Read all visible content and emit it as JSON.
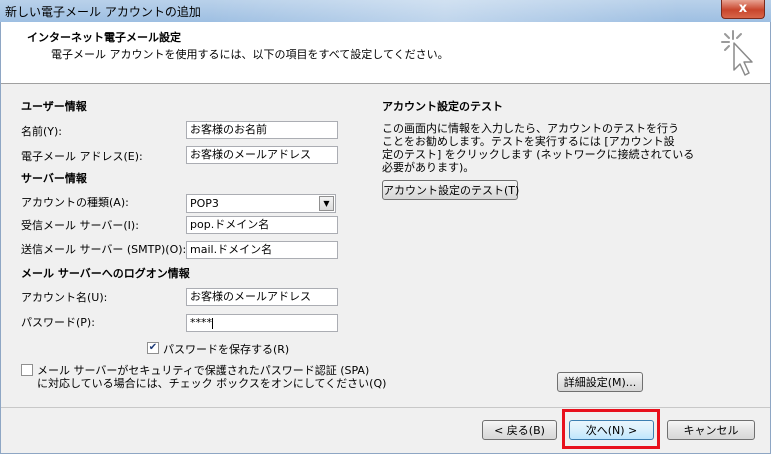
{
  "window": {
    "title": "新しい電子メール アカウントの追加",
    "close_label": "x"
  },
  "header": {
    "title": "インターネット電子メール設定",
    "subtitle": "電子メール アカウントを使用するには、以下の項目をすべて設定してください。"
  },
  "user_info": {
    "heading": "ユーザー情報",
    "name_label": "名前(Y):",
    "name_value": "お客様のお名前",
    "email_label": "電子メール アドレス(E):",
    "email_value": "お客様のメールアドレス"
  },
  "server_info": {
    "heading": "サーバー情報",
    "account_type_label": "アカウントの種類(A):",
    "account_type_value": "POP3",
    "incoming_label": "受信メール サーバー(I):",
    "incoming_value": "pop.ドメイン名",
    "outgoing_label": "送信メール サーバー (SMTP)(O):",
    "outgoing_value": "mail.ドメイン名"
  },
  "logon_info": {
    "heading": "メール サーバーへのログオン情報",
    "account_name_label": "アカウント名(U):",
    "account_name_value": "お客様のメールアドレス",
    "password_label": "パスワード(P):",
    "password_value": "****",
    "save_password_label": "パスワードを保存する(R)",
    "save_password_checked": true,
    "spa_label_line1": "メール サーバーがセキュリティで保護されたパスワード認証 (SPA)",
    "spa_label_line2": "に対応している場合には、チェック ボックスをオンにしてください(Q)",
    "spa_checked": false
  },
  "test": {
    "heading": "アカウント設定のテスト",
    "desc_line1": "この画面内に情報を入力したら、アカウントのテストを行う",
    "desc_line2": "ことをお勧めします。テストを実行するには [アカウント設",
    "desc_line3": "定のテスト] をクリックします (ネットワークに接続されている",
    "desc_line4": "必要があります)。",
    "test_button": "アカウント設定のテスト(T)"
  },
  "buttons": {
    "more_settings": "詳細設定(M)...",
    "back": "< 戻る(B)",
    "next": "次へ(N) >",
    "cancel": "キャンセル"
  },
  "colors": {
    "highlight": "#e8101c",
    "accent": "#3c7fb1"
  }
}
